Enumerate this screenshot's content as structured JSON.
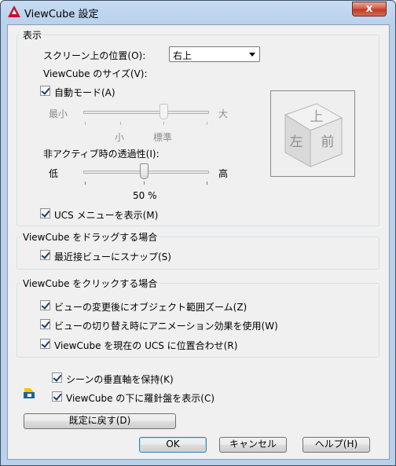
{
  "window": {
    "title": "ViewCube 設定",
    "close_glyph": "x",
    "icon": "autocad-icon"
  },
  "display": {
    "group_title": "表示",
    "position_label": "スクリーン上の位置(O):",
    "position_value": "右上",
    "size_label": "ViewCube のサイズ(V):",
    "auto_mode_label": "自動モード(A)",
    "size_min": "最小",
    "size_max": "大",
    "size_small": "小",
    "size_standard": "標準",
    "opacity_label": "非アクティブ時の透過性(I):",
    "opacity_low": "低",
    "opacity_high": "高",
    "opacity_value": "50 %",
    "opacity_percent": 50,
    "ucs_menu_label": "UCS メニューを表示(M)"
  },
  "cube": {
    "top": "上",
    "front": "前",
    "left": "左"
  },
  "drag": {
    "group_title": "ViewCube をドラッグする場合",
    "snap_label": "最近接ビューにスナップ(S)"
  },
  "click": {
    "group_title": "ViewCube をクリックする場合",
    "zoom_label": "ビューの変更後にオブジェクト範囲ズーム(Z)",
    "animate_label": "ビューの切り替え時にアニメーション効果を使用(W)",
    "align_label": "ViewCube を現在の UCS に位置合わせ(R)"
  },
  "extra": {
    "keep_up_label": "シーンの垂直軸を保持(K)",
    "compass_label": "ViewCube の下に羅針盤を表示(C)"
  },
  "buttons": {
    "restore": "既定に戻す(D)",
    "ok": "OK",
    "cancel": "キャンセル",
    "help": "ヘルプ(H)"
  }
}
